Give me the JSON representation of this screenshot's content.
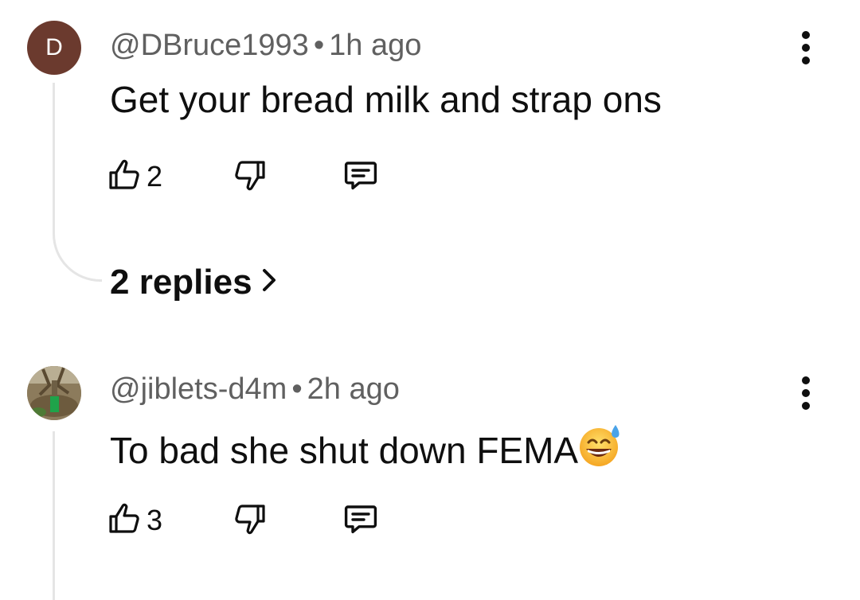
{
  "colors": {
    "avatar_bg": "#6b3a2e",
    "meta_text": "#606060",
    "thread_line": "#e5e5e5"
  },
  "comments": [
    {
      "avatar_letter": "D",
      "username": "@DBruce1993",
      "separator": "•",
      "time": "1h ago",
      "text": "Get your bread milk and strap ons",
      "likes": "2",
      "replies_label": "2 replies"
    },
    {
      "avatar_image": "green-tree-photo",
      "username": "@jiblets-d4m",
      "separator": "•",
      "time": "2h ago",
      "text": "To bad she shut down FEMA",
      "emoji": "grinning-face-with-sweat",
      "likes": "3"
    }
  ]
}
